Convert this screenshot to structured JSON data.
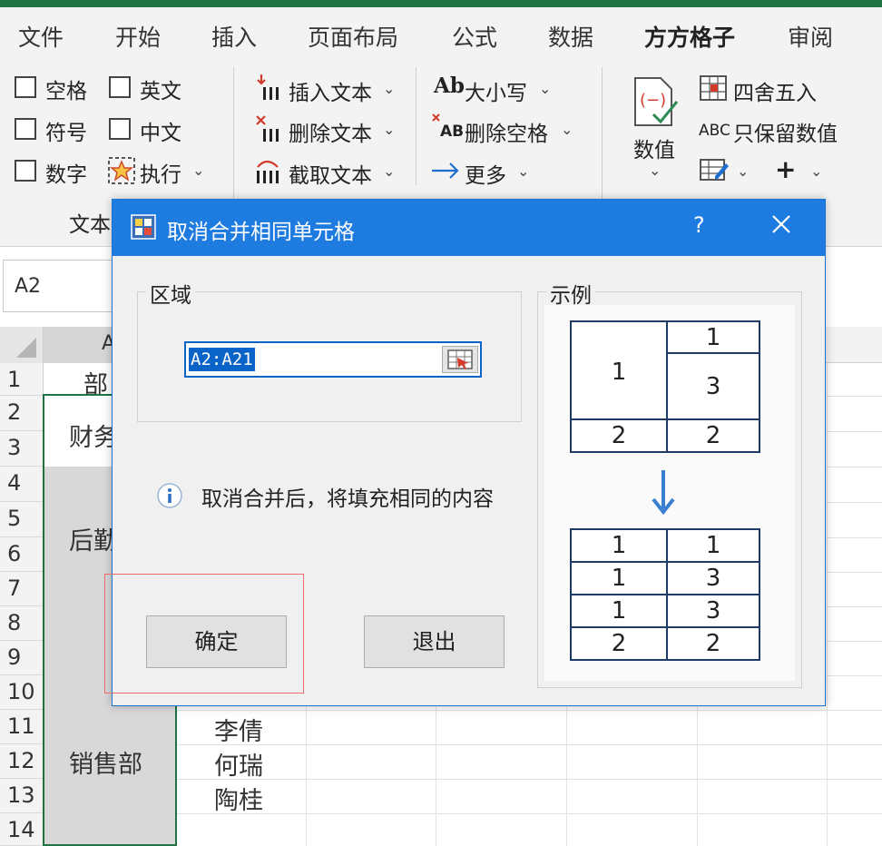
{
  "ribbon": {
    "tabs": [
      "文件",
      "开始",
      "插入",
      "页面布局",
      "公式",
      "数据",
      "方方格子",
      "审阅"
    ],
    "active_tab": "方方格子",
    "checkboxes": [
      "空格",
      "英文",
      "符号",
      "中文",
      "数字"
    ],
    "execute_label": "执行",
    "text_ops": [
      "插入文本",
      "删除文本",
      "截取文本"
    ],
    "case_label": "大小写",
    "remove_space_label": "删除空格",
    "more_label": "更多",
    "numeric_label": "数值",
    "round_label": "四舍五入",
    "keep_numeric_label": "只保留数值",
    "group_label": "文本"
  },
  "formula_bar": {
    "name_box": "A2"
  },
  "sheet": {
    "column_a": "A",
    "rows": [
      "1",
      "2",
      "3",
      "4",
      "5",
      "6",
      "7",
      "8",
      "9",
      "10",
      "11",
      "12",
      "13",
      "14"
    ],
    "a1_partial": "部",
    "dept_finance_partial": "财务",
    "dept_logistics_partial": "后勤",
    "dept_sales": "销售部",
    "names": [
      "李倩",
      "何瑞",
      "陶桂"
    ]
  },
  "dialog": {
    "title": "取消合并相同单元格",
    "help": "?",
    "range_group_label": "区域",
    "range_value": "A2:A21",
    "info_text": "取消合并后，将填充相同的内容",
    "ok_label": "确定",
    "exit_label": "退出",
    "example_label": "示例",
    "example_before": [
      "1",
      "1",
      "3",
      "2",
      "2"
    ],
    "example_after": [
      "1",
      "1",
      "1",
      "3",
      "1",
      "3",
      "2",
      "2"
    ]
  },
  "colors": {
    "accent_green": "#217346",
    "dialog_title_blue": "#1e7be0",
    "highlight_red": "#ef6a6a"
  }
}
